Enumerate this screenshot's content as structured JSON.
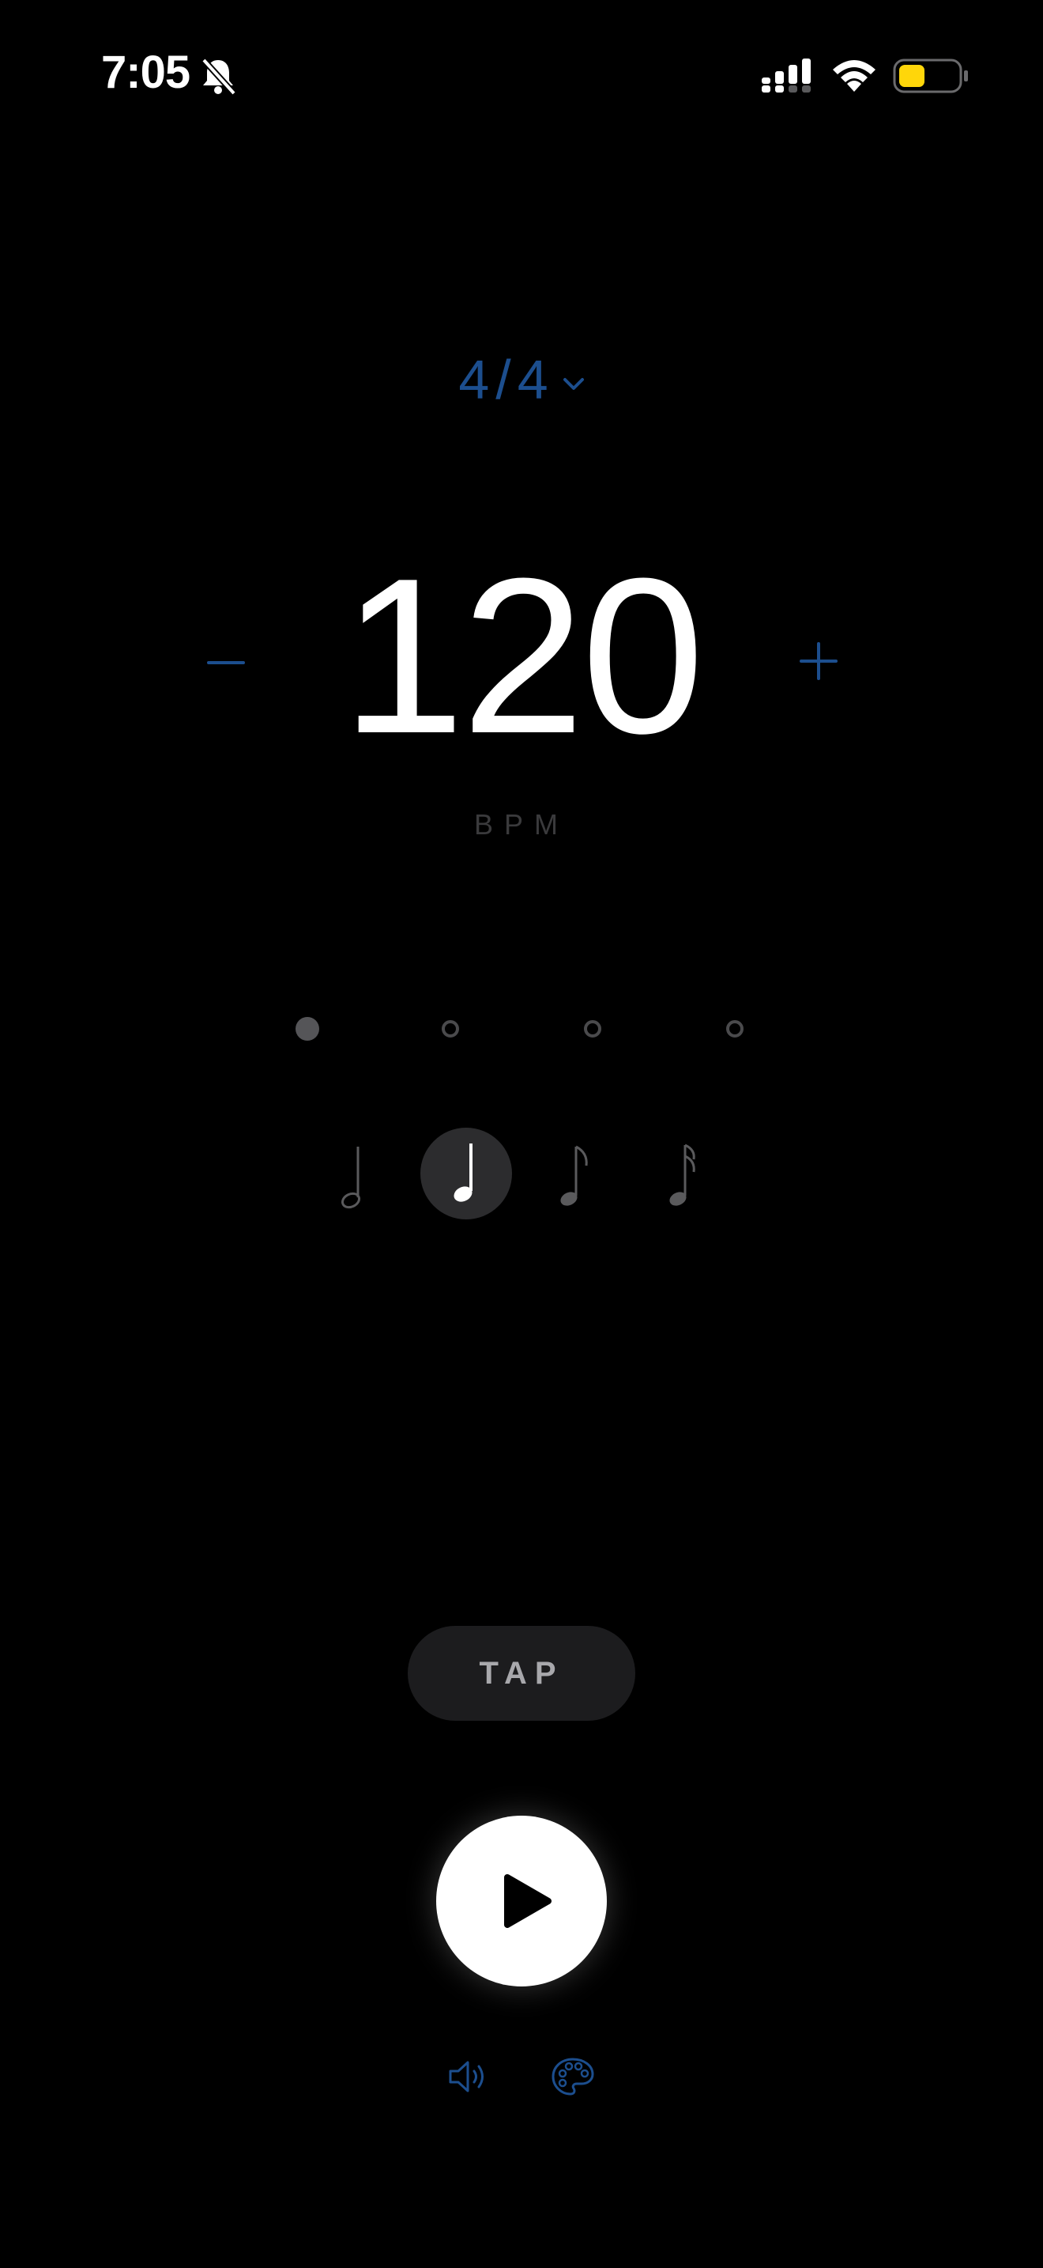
{
  "status_bar": {
    "time": "7:05",
    "icons": [
      "bell-slash-icon",
      "cellular-signal-icon",
      "wifi-icon",
      "battery-icon"
    ],
    "battery_color": "#ffd60a"
  },
  "metronome": {
    "time_signature": "4/4",
    "bpm": "120",
    "bpm_label": "BPM",
    "decrement_icon": "minus-icon",
    "increment_icon": "plus-icon",
    "beats": [
      {
        "state": "active"
      },
      {
        "state": "inactive"
      },
      {
        "state": "inactive"
      },
      {
        "state": "inactive"
      }
    ],
    "subdivisions": [
      {
        "icon": "half-note-icon",
        "selected": false
      },
      {
        "icon": "quarter-note-icon",
        "selected": true
      },
      {
        "icon": "eighth-note-icon",
        "selected": false
      },
      {
        "icon": "sixteenth-note-icon",
        "selected": false
      }
    ],
    "tap_label": "TAP",
    "play_icon": "play-icon",
    "bottom_icons": [
      "speaker-icon",
      "palette-icon"
    ]
  },
  "colors": {
    "background": "#000000",
    "accent": "#1c4e8e",
    "muted_text": "#3a3a3c",
    "tap_bg": "#1c1c1e"
  }
}
